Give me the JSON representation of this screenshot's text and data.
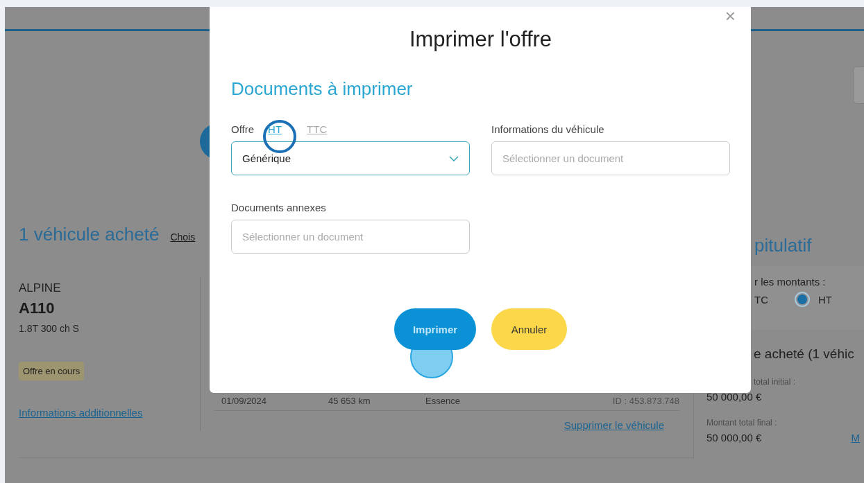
{
  "page": {
    "vehicles_heading": "1 véhicule acheté",
    "choose_link": "Chois",
    "vehicle": {
      "brand": "ALPINE",
      "model": "A110",
      "version": "1.8T 300 ch S",
      "status": "Offre en cours",
      "info_link": "Informations additionnelles",
      "details": [
        "01/09/2024",
        "45 653 km",
        "Essence",
        "ID : 453.873.748"
      ],
      "delete_link": "Supprimer le véhicule"
    },
    "summary": {
      "title": "pitulatif",
      "amounts_label": "r les montants :",
      "partial_option_label": "TC",
      "option": {
        "label": "HT",
        "selected": true
      },
      "subtitle": "e acheté (1 véhic",
      "rows": [
        {
          "label": "total initial :",
          "value": "50 000,00 €"
        },
        {
          "label": "Montant total final :",
          "value": "50 000,00 €",
          "link": "M"
        }
      ]
    }
  },
  "modal": {
    "title": "Imprimer l'offre",
    "close": "×",
    "section_title": "Documents à imprimer",
    "offer_label": "Offre",
    "offer_options": [
      {
        "label": "HT",
        "selected": true
      },
      {
        "label": "TTC",
        "selected": false
      }
    ],
    "offer_select": {
      "value": "Générique"
    },
    "vehicle_info": {
      "label": "Informations du véhicule",
      "placeholder": "Sélectionner un document"
    },
    "annexes": {
      "label": "Documents annexes",
      "placeholder": "Sélectionner un document"
    },
    "buttons": [
      {
        "label": "Imprimer",
        "kind": "primary"
      },
      {
        "label": "Annuler",
        "kind": "secondary"
      }
    ]
  }
}
